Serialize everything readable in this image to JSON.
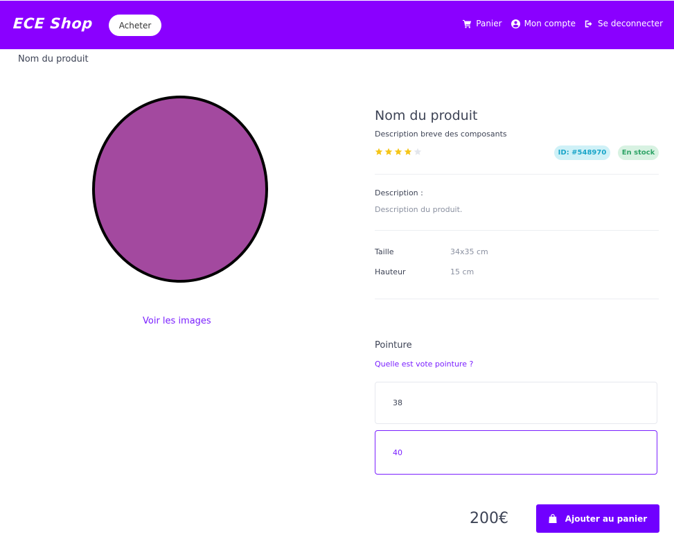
{
  "header": {
    "brand": "ECE Shop",
    "buy_label": "Acheter",
    "nav": [
      {
        "label": "Panier",
        "icon": "cart-icon"
      },
      {
        "label": "Mon compte",
        "icon": "user-circle-icon"
      },
      {
        "label": "Se deconnecter",
        "icon": "logout-icon"
      }
    ],
    "bg_color": "#8a00ff"
  },
  "breadcrumb": "Nom du produit",
  "gallery": {
    "link_label": "Voir les images",
    "image_fill": "#a3499f"
  },
  "product": {
    "title": "Nom du produit",
    "subtitle": "Description breve des composants",
    "rating": 4,
    "rating_max": 5,
    "id_badge": "ID: #548970",
    "stock_badge": "En stock",
    "description_label": "Description :",
    "description_text": "Description du produit.",
    "specs": [
      {
        "label": "Taille",
        "value": "34x35 cm"
      },
      {
        "label": "Hauteur",
        "value": "15 cm"
      }
    ]
  },
  "sizes": {
    "title": "Pointure",
    "question": "Quelle est vote pointure ?",
    "options": [
      "38",
      "40"
    ],
    "selected": "40"
  },
  "purchase": {
    "price": "200€",
    "add_label": "Ajouter au panier",
    "accent_color": "#7000ff"
  }
}
